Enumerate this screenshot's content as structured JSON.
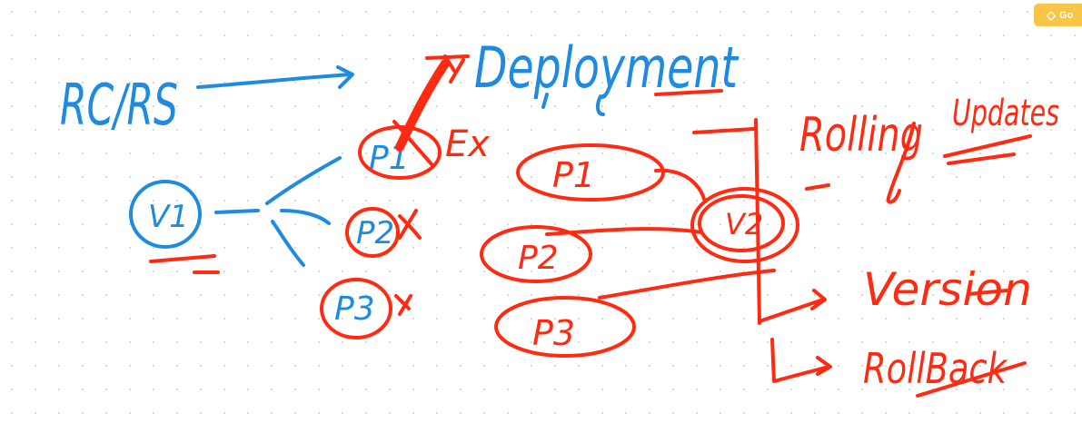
{
  "colors": {
    "blue_ink": "#1e8be0",
    "red_ink": "#ff2a12",
    "badge": "#f7c548"
  },
  "badge": {
    "icon": "gem-icon",
    "label": "Go"
  },
  "notes": {
    "rc_rs": "RC/RS",
    "deployment": "Deployment",
    "v1": "V1",
    "blue_pods": [
      "P1",
      "P2",
      "P3"
    ],
    "ex": "Ex",
    "red_pods": [
      "P1",
      "P2",
      "P3"
    ],
    "v2": "V2",
    "rolling": "Rolling",
    "updates": "Updates",
    "version": "Version",
    "rollback": "RollBack"
  }
}
